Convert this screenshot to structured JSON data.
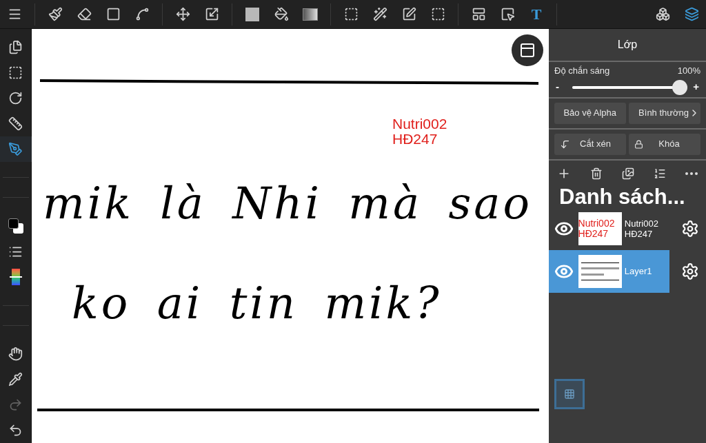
{
  "toolbar": {
    "tools": [
      {
        "kind": "menu",
        "selected": false
      },
      {
        "kind": "brush",
        "selected": false
      },
      {
        "kind": "eraser",
        "selected": false
      },
      {
        "kind": "shape",
        "selected": false
      },
      {
        "kind": "dotpen",
        "selected": false
      },
      {
        "kind": "move",
        "selected": false
      },
      {
        "kind": "transform",
        "selected": false
      },
      {
        "kind": "fillcolor",
        "selected": false
      },
      {
        "kind": "bucket",
        "selected": false
      },
      {
        "kind": "gradient",
        "selected": false
      },
      {
        "kind": "select",
        "selected": false
      },
      {
        "kind": "wand",
        "selected": false
      },
      {
        "kind": "selectpen",
        "selected": false
      },
      {
        "kind": "selecteraser",
        "selected": false
      },
      {
        "kind": "layout",
        "selected": false
      },
      {
        "kind": "pointer",
        "selected": false
      },
      {
        "kind": "text",
        "label": "T",
        "selected": true
      },
      {
        "kind": "materials",
        "selected": false
      },
      {
        "kind": "layers",
        "selected": true
      }
    ]
  },
  "sidebar": {
    "tools": [
      {
        "kind": "pages",
        "selected": false
      },
      {
        "kind": "selectlist",
        "selected": false
      },
      {
        "kind": "rotate",
        "selected": false
      },
      {
        "kind": "ruler",
        "selected": false
      },
      {
        "kind": "pen",
        "selected": true
      },
      {
        "kind": "colors",
        "selected": false
      },
      {
        "kind": "list",
        "selected": false
      },
      {
        "kind": "palette",
        "selected": false
      },
      {
        "kind": "hand",
        "selected": false
      },
      {
        "kind": "dropper",
        "selected": false
      },
      {
        "kind": "redo",
        "selected": false,
        "disabled": true
      },
      {
        "kind": "undo",
        "selected": false,
        "disabled": false
      }
    ]
  },
  "canvas": {
    "text_layer": [
      "Nutri002",
      "HĐ247"
    ],
    "handwriting": [
      "mik là Nhi mà sao",
      "ko ai tin mik?"
    ]
  },
  "layer_panel": {
    "title": "Lớp",
    "opacity_label": "Độ chắn sáng",
    "opacity_reading": "100%",
    "opacity": {
      "level": 1
    },
    "minus": "-",
    "plus": "+",
    "alpha_button": "Bảo vệ Alpha",
    "blend_button": "Bình thường",
    "clip_button": "Cắt xén",
    "lock_button": "Khóa",
    "list_title": "Danh sách...",
    "layers": [
      {
        "kind": "text",
        "thumb_lines": [
          "Nutri002",
          "HĐ247"
        ],
        "name": "Nutri002\nHĐ247",
        "visible": true,
        "selected": false
      },
      {
        "kind": "drawing",
        "name": "Layer1",
        "visible": true,
        "selected": true
      }
    ]
  }
}
